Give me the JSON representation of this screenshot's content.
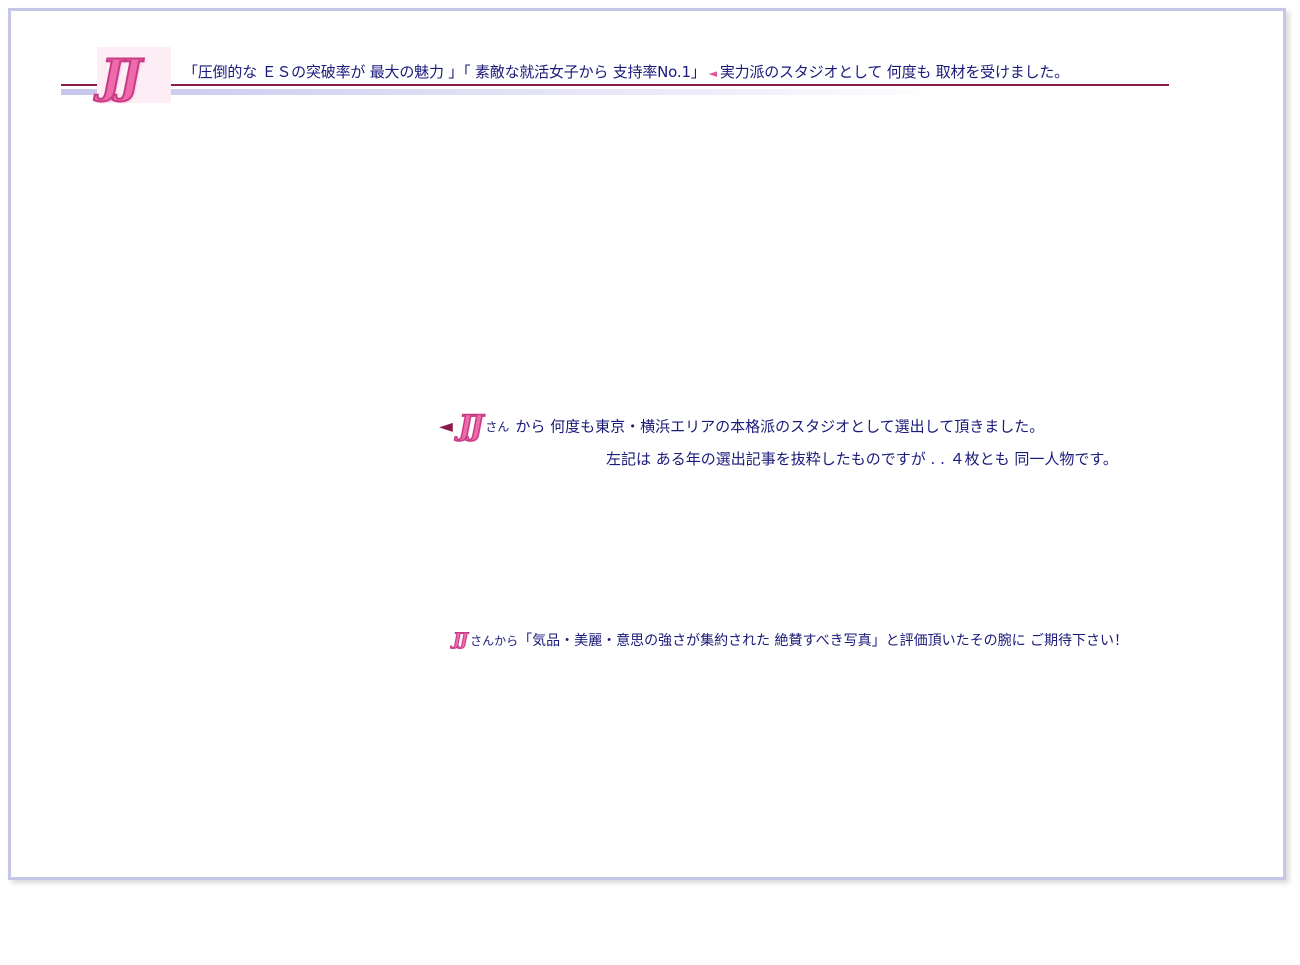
{
  "header": {
    "logo_text": "JJ",
    "headline": "「圧倒的な ＥＳの突破率が 最大の魅力 」「 素敵な就活女子から 支持率No.1」",
    "marker": "◄",
    "headline_tail": "実力派のスタジオとして 何度も 取材を受けました。"
  },
  "feature": {
    "marker": "◄",
    "logo_text": "JJ",
    "san": "さん",
    "line1": "から 何度も東京・横浜エリアの本格派のスタジオとして選出して頂きました。",
    "line2": "左記は ある年の選出記事を抜粋したものですが . .  ４枚とも 同一人物です。"
  },
  "review": {
    "logo_text": "JJ",
    "prefix": "さんから",
    "quote": "「気品・美麗・意思の強さが集約された 絶賛すべき写真」と評価頂いたその腕に ご期待下さい！"
  },
  "colors": {
    "frame_border": "#c6c6e6",
    "text_navy": "#1a1a7a",
    "rule_maroon": "#8a1a4a",
    "logo_pink": "#ee6aab"
  }
}
